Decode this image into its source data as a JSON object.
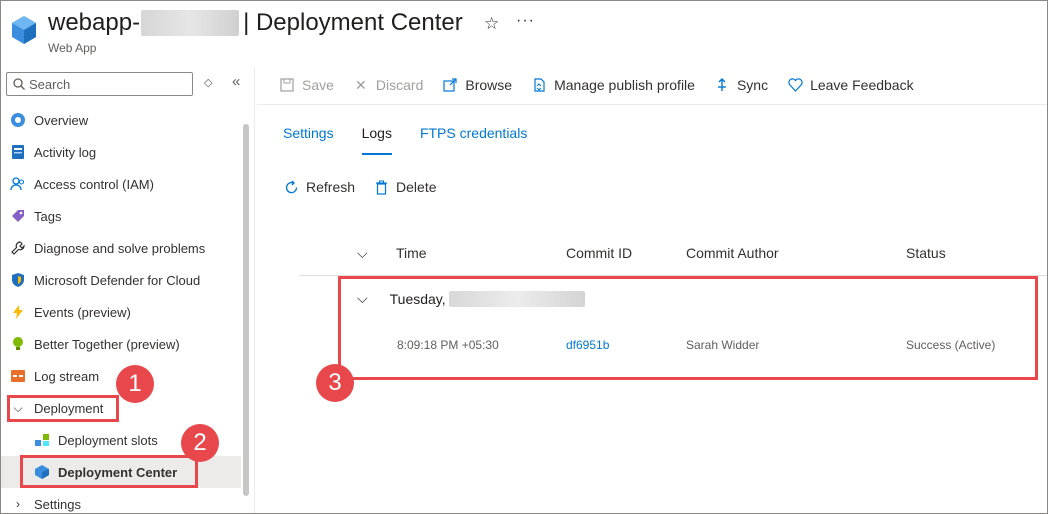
{
  "header": {
    "title_prefix": "webapp-",
    "title_suffix": "| Deployment Center",
    "subtitle": "Web App",
    "favorite_icon": "star-icon",
    "more_icon": "ellipsis-icon"
  },
  "sidebar": {
    "search_placeholder": "Search",
    "items": [
      {
        "label": "Overview",
        "icon": "overview-icon"
      },
      {
        "label": "Activity log",
        "icon": "activity-log-icon"
      },
      {
        "label": "Access control (IAM)",
        "icon": "people-icon"
      },
      {
        "label": "Tags",
        "icon": "tag-icon"
      },
      {
        "label": "Diagnose and solve problems",
        "icon": "wrench-icon"
      },
      {
        "label": "Microsoft Defender for Cloud",
        "icon": "shield-icon"
      },
      {
        "label": "Events (preview)",
        "icon": "lightning-icon"
      },
      {
        "label": "Better Together (preview)",
        "icon": "lightbulb-icon"
      },
      {
        "label": "Log stream",
        "icon": "log-stream-icon"
      },
      {
        "label": "Deployment",
        "icon": "chevron-down-icon"
      },
      {
        "label": "Deployment slots",
        "icon": "deployment-slots-icon"
      },
      {
        "label": "Deployment Center",
        "icon": "deployment-center-icon"
      },
      {
        "label": "Settings",
        "icon": "chevron-right-icon"
      }
    ]
  },
  "toolbar": {
    "save": "Save",
    "discard": "Discard",
    "browse": "Browse",
    "manage_publish_profile": "Manage publish profile",
    "sync": "Sync",
    "leave_feedback": "Leave Feedback"
  },
  "tabs": {
    "settings": "Settings",
    "logs": "Logs",
    "ftps": "FTPS credentials",
    "active": "Logs"
  },
  "logs_toolbar": {
    "refresh": "Refresh",
    "delete": "Delete"
  },
  "grid": {
    "columns": [
      "Time",
      "Commit ID",
      "Commit Author",
      "Status"
    ],
    "group_label": "Tuesday,",
    "rows": [
      {
        "time": "8:09:18 PM +05:30",
        "commit_id": "df6951b",
        "author": "Sarah Widder",
        "status": "Success (Active)"
      }
    ]
  },
  "callouts": [
    "1",
    "2",
    "3"
  ],
  "colors": {
    "accent": "#0078d4",
    "callout": "#e8474b"
  }
}
